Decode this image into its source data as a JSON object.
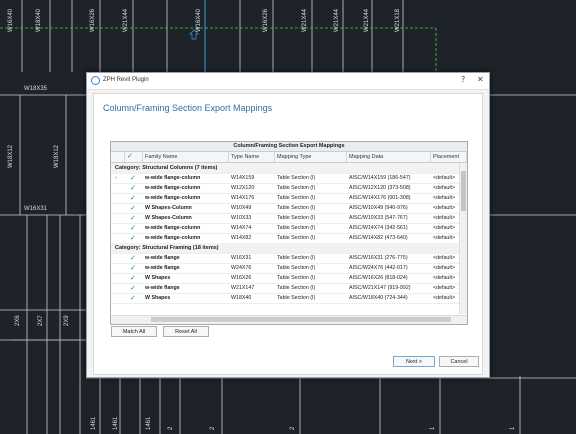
{
  "cad": {
    "top_labels": [
      "W16X40",
      "W18X40",
      "W16X26",
      "W21X44",
      "W16X40",
      "W16X26",
      "W21X44",
      "W21X44",
      "W21X44",
      "W21X18"
    ],
    "left_labels": [
      "W18X35",
      "W18X12",
      "W18X12",
      "W16X31"
    ],
    "lower_labels": [
      "2X6",
      "2X7",
      "2X9",
      "1461",
      "1461",
      "1461",
      "2",
      "2",
      "2",
      "1",
      "1"
    ]
  },
  "dialog": {
    "app_title": "ZPH Revit Plugin",
    "help_glyph": "?",
    "close_glyph": "✕",
    "heading": "Column/Framing Section Export Mappings",
    "grid_title": "Column/Framing Section Export Mappings",
    "columns": [
      "Family Name",
      "Type Name",
      "Mapping Type",
      "Mapping Data",
      "Placement"
    ],
    "check_header": "✓",
    "categories": [
      {
        "label": "Category:  Structural Columns (7 items)",
        "rows": [
          {
            "family": "w-wide flange-column",
            "type": "W14X159",
            "mtype": "Table Section (I)",
            "mdata": "AISC/W14X159 (186-547)",
            "place": "<default>"
          },
          {
            "family": "w-wide flange-column",
            "type": "W12X120",
            "mtype": "Table Section (I)",
            "mdata": "AISC/W12X120 (373-508)",
            "place": "<default>"
          },
          {
            "family": "w-wide flange-column",
            "type": "W14X176",
            "mtype": "Table Section (I)",
            "mdata": "AISC/W14X176 (001-308)",
            "place": "<default>"
          },
          {
            "family": "W Shapes-Column",
            "type": "W10X49",
            "mtype": "Table Section (I)",
            "mdata": "AISC/W10X49 (940-976)",
            "place": "<default>"
          },
          {
            "family": "W Shapes-Column",
            "type": "W10X33",
            "mtype": "Table Section (I)",
            "mdata": "AISC/W10X33 (547-767)",
            "place": "<default>"
          },
          {
            "family": "w-wide flange-column",
            "type": "W14X74",
            "mtype": "Table Section (I)",
            "mdata": "AISC/W14X74 (342-561)",
            "place": "<default>"
          },
          {
            "family": "w-wide flange-column",
            "type": "W14X82",
            "mtype": "Table Section (I)",
            "mdata": "AISC/W14X82 (473-640)",
            "place": "<default>"
          }
        ]
      },
      {
        "label": "Category:  Structural Framing (18 items)",
        "rows": [
          {
            "family": "w-wide flange",
            "type": "W16X31",
            "mtype": "Table Section (I)",
            "mdata": "AISC/W16X31 (276-775)",
            "place": "<default>"
          },
          {
            "family": "w-wide flange",
            "type": "W24X76",
            "mtype": "Table Section (I)",
            "mdata": "AISC/W24X76 (442-017)",
            "place": "<default>"
          },
          {
            "family": "W Shapes",
            "type": "W16X26",
            "mtype": "Table Section (I)",
            "mdata": "AISC/W16X26 (818-024)",
            "place": "<default>"
          },
          {
            "family": "w-wide flange",
            "type": "W21X147",
            "mtype": "Table Section (I)",
            "mdata": "AISC/W21X147 (919-992)",
            "place": "<default>"
          },
          {
            "family": "W Shapes",
            "type": "W18X40",
            "mtype": "Table Section (I)",
            "mdata": "AISC/W18X40 (724-344)",
            "place": "<default>"
          }
        ]
      }
    ],
    "match_all": "Match All",
    "reset_all": "Reset All",
    "next": "Next >",
    "cancel": "Cancel"
  }
}
